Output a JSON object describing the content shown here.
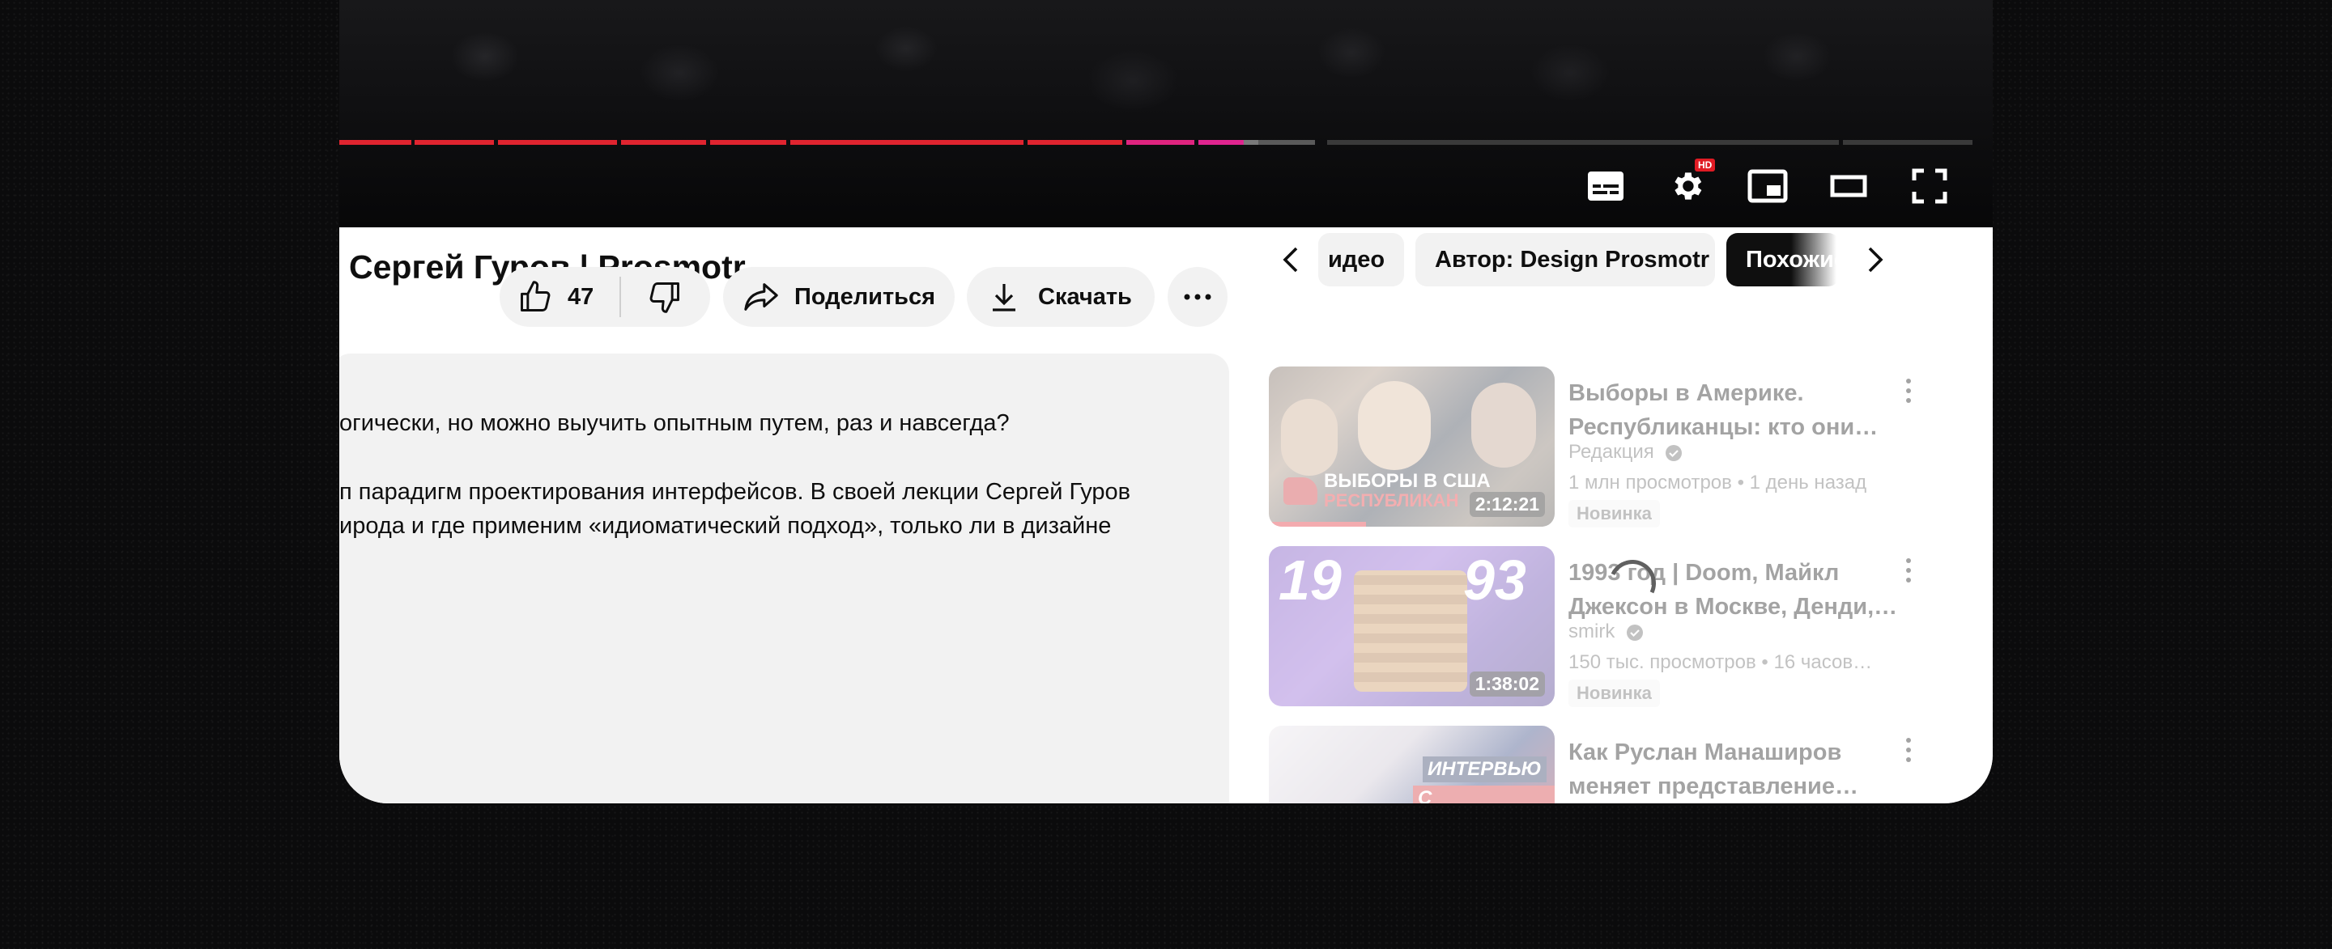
{
  "video": {
    "title": "Сергей Гуров | Prosmotr",
    "likes": "47",
    "share_label": "Поделиться",
    "download_label": "Скачать",
    "hd_badge": "HD"
  },
  "player": {
    "progress_fraction": 0.56,
    "controls": [
      "subtitles-icon",
      "settings-icon",
      "miniplayer-icon",
      "theater-mode-icon",
      "fullscreen-icon"
    ]
  },
  "description": {
    "line1": "огически, но можно выучить опытным путем, раз и навсегда?",
    "line2": "п парадигм проектирования интерфейсов. В своей лекции Сергей Гуров",
    "line3": "ирода и где применим «идиоматический подход», только ли в дизайне"
  },
  "chips": {
    "chip1": "идео",
    "chip2": "Автор: Design Prosmotr",
    "chip3": "Похожие"
  },
  "recommendations": [
    {
      "title": "Выборы в Америке. Республиканцы: кто они…",
      "channel": "Редакция",
      "views": "1 млн просмотров",
      "age": "1 день назад",
      "badge": "Новинка",
      "duration": "2:12:21",
      "thumb_text1": "ВЫБОРЫ В США",
      "thumb_text2": "РЕСПУБЛИКАН"
    },
    {
      "title": "1993 год | Doom, Майкл Джексон в Москве, Денди,…",
      "channel": "smirk",
      "views": "150 тыс. просмотров",
      "age": "16 часов…",
      "badge": "Новинка",
      "duration": "1:38:02",
      "thumb_text1": "19",
      "thumb_text2": "93"
    },
    {
      "title": "Как Руслан Манаширов меняет представление…",
      "thumb_text1": "ИНТЕРВЬЮ",
      "thumb_text2": "С ДИАСПОРОЙ"
    }
  ],
  "colors": {
    "progress_played": "#e0242f",
    "progress_buffer": "#5a5a5a",
    "pill_bg": "#f2f2f2",
    "chip_active": "#0f0f0f"
  }
}
